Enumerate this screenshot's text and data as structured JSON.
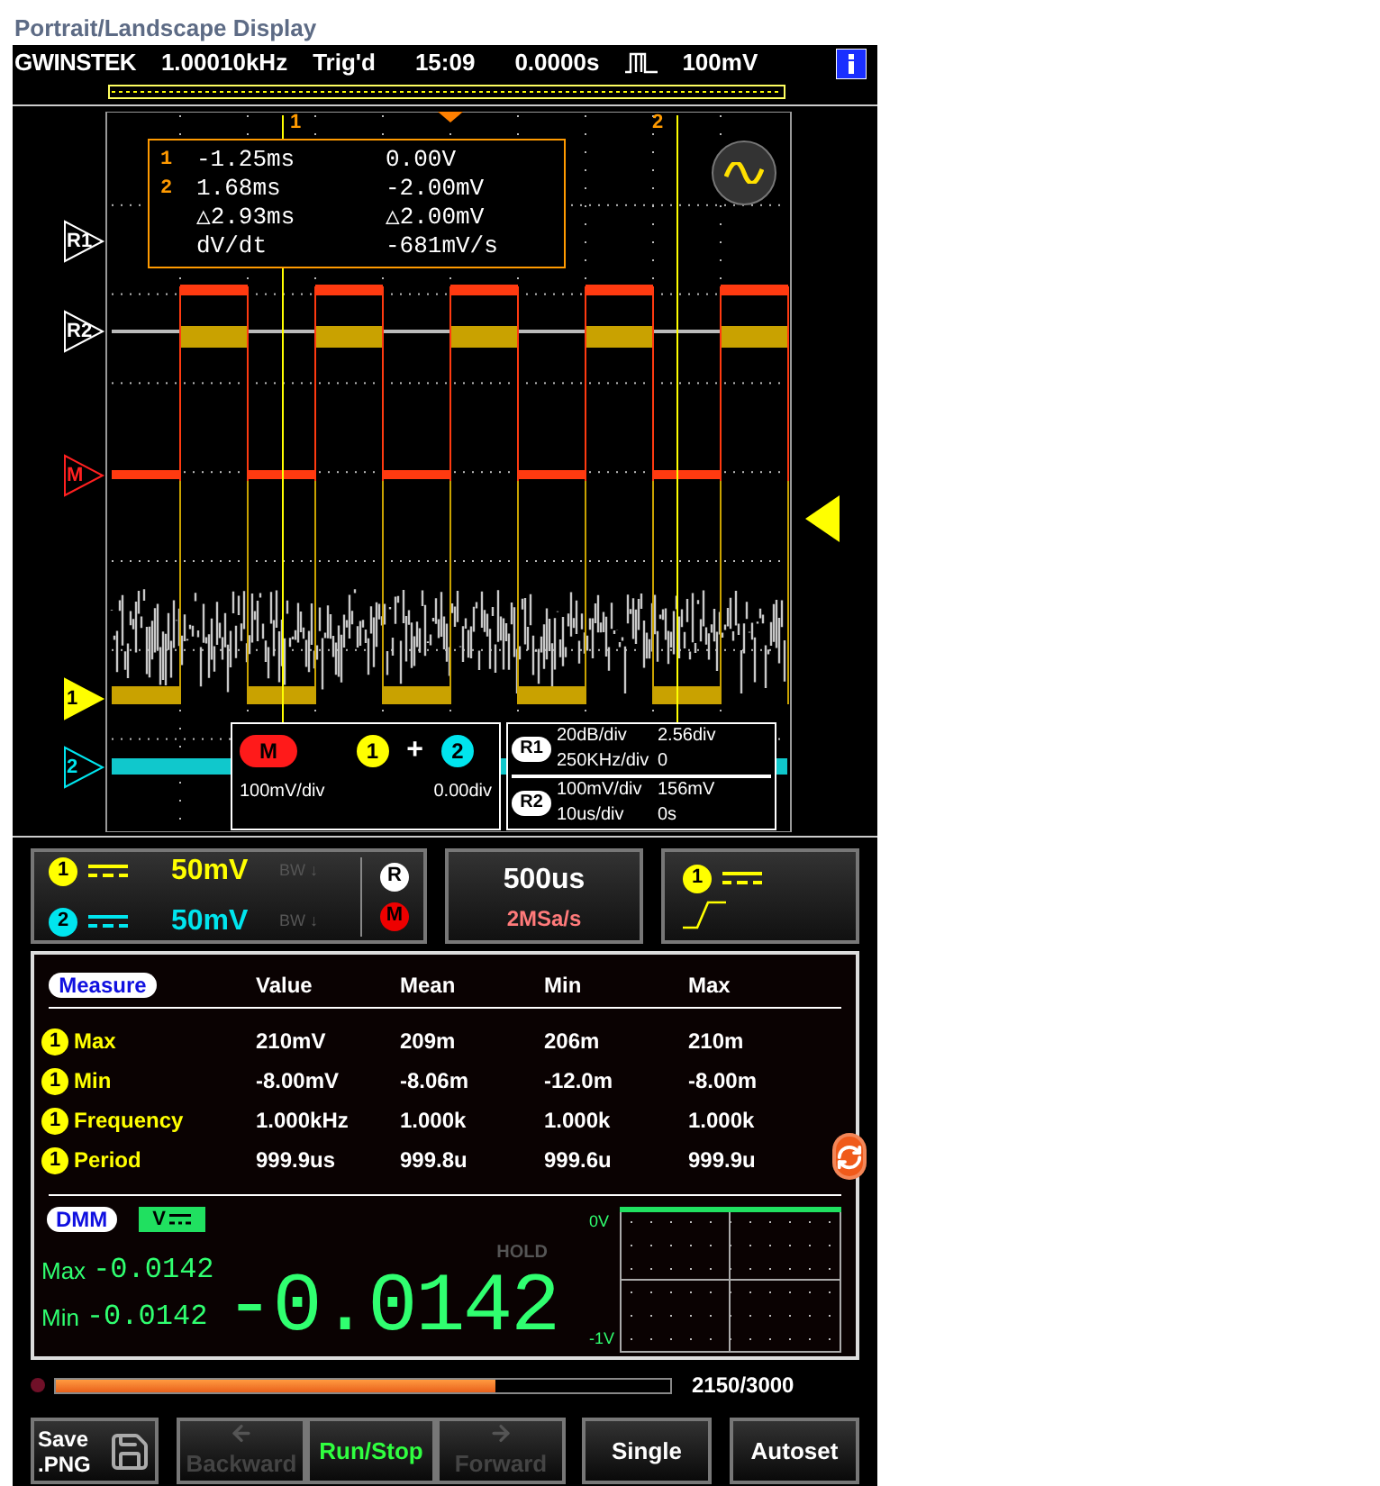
{
  "page_title": "Portrait/Landscape Display",
  "status_bar": {
    "brand": "GWINSTEK",
    "items": [
      "1.00010kHz",
      "Trig'd",
      "15:09",
      "0.0000s"
    ],
    "trigger_level": "100mV"
  },
  "display": {
    "cursor_labels": [
      "1",
      "2"
    ],
    "markers": [
      {
        "label": "R1",
        "kind": "ref"
      },
      {
        "label": "R2",
        "kind": "ref"
      },
      {
        "label": "M",
        "kind": "math"
      },
      {
        "label": "1",
        "kind": "ch1"
      },
      {
        "label": "2",
        "kind": "ch2"
      }
    ],
    "cursor_readout": [
      {
        "label": "1",
        "time": "-1.25ms",
        "value": "0.00V"
      },
      {
        "label": "2",
        "time": "1.68ms",
        "value": "-2.00mV"
      },
      {
        "time": "△2.93ms",
        "value": "△2.00mV"
      },
      {
        "time": "dV/dt",
        "value": "-681mV/s"
      }
    ],
    "math": {
      "badge": "M",
      "operand_a": "1",
      "operator": "+",
      "operand_b": "2",
      "scale": "100mV/div",
      "offset": "0.00div"
    },
    "refs": [
      {
        "badge": "R1",
        "lines": [
          [
            "20dB/div",
            "2.56div"
          ],
          [
            "250KHz/div",
            "0"
          ]
        ]
      },
      {
        "badge": "R2",
        "lines": [
          [
            "100mV/div",
            "156mV"
          ],
          [
            "10us/div",
            "0s"
          ]
        ]
      }
    ]
  },
  "channels": [
    {
      "badge": "1",
      "scale": "50mV",
      "bw": "BW ↓",
      "color": "#ffff00"
    },
    {
      "badge": "2",
      "scale": "50mV",
      "bw": "BW ↓",
      "color": "#00e5ee"
    }
  ],
  "side_badges": [
    {
      "label": "R",
      "kind": "ref"
    },
    {
      "label": "M",
      "kind": "math"
    }
  ],
  "timebase": {
    "scale": "500us",
    "sample_rate": "2MSa/s"
  },
  "trigger": {
    "source": "1"
  },
  "measure": {
    "badge": "Measure",
    "columns": [
      "Value",
      "Mean",
      "Min",
      "Max"
    ],
    "rows": [
      {
        "source": "1",
        "name": "Max",
        "values": [
          "210mV",
          "209m",
          "206m",
          "210m"
        ]
      },
      {
        "source": "1",
        "name": "Min",
        "values": [
          "-8.00mV",
          "-8.06m",
          "-12.0m",
          "-8.00m"
        ]
      },
      {
        "source": "1",
        "name": "Frequency",
        "values": [
          "1.000kHz",
          "1.000k",
          "1.000k",
          "1.000k"
        ]
      },
      {
        "source": "1",
        "name": "Period",
        "values": [
          "999.9us",
          "999.8u",
          "999.6u",
          "999.9u"
        ]
      }
    ]
  },
  "dmm": {
    "badge": "DMM",
    "mode": "V",
    "hold": "HOLD",
    "max_label": "Max",
    "max": "-0.0142",
    "min_label": "Min",
    "min": "-0.0142",
    "reading": "-0.0142",
    "top_label": "0V",
    "bottom_label": "-1V"
  },
  "record": {
    "level": 0.717,
    "reading": "2150/3000"
  },
  "buttons": [
    {
      "label": "Save",
      "sublabel": ".PNG",
      "kind": "save",
      "disabled": false
    },
    {
      "label": "Backward",
      "kind": "group",
      "disabled": true
    },
    {
      "label": "Run/Stop",
      "kind": "group",
      "disabled": false
    },
    {
      "label": "Forward",
      "kind": "group",
      "disabled": true
    },
    {
      "label": "Single",
      "kind": "plain",
      "disabled": false
    },
    {
      "label": "Autoset",
      "kind": "plain",
      "disabled": false
    }
  ]
}
